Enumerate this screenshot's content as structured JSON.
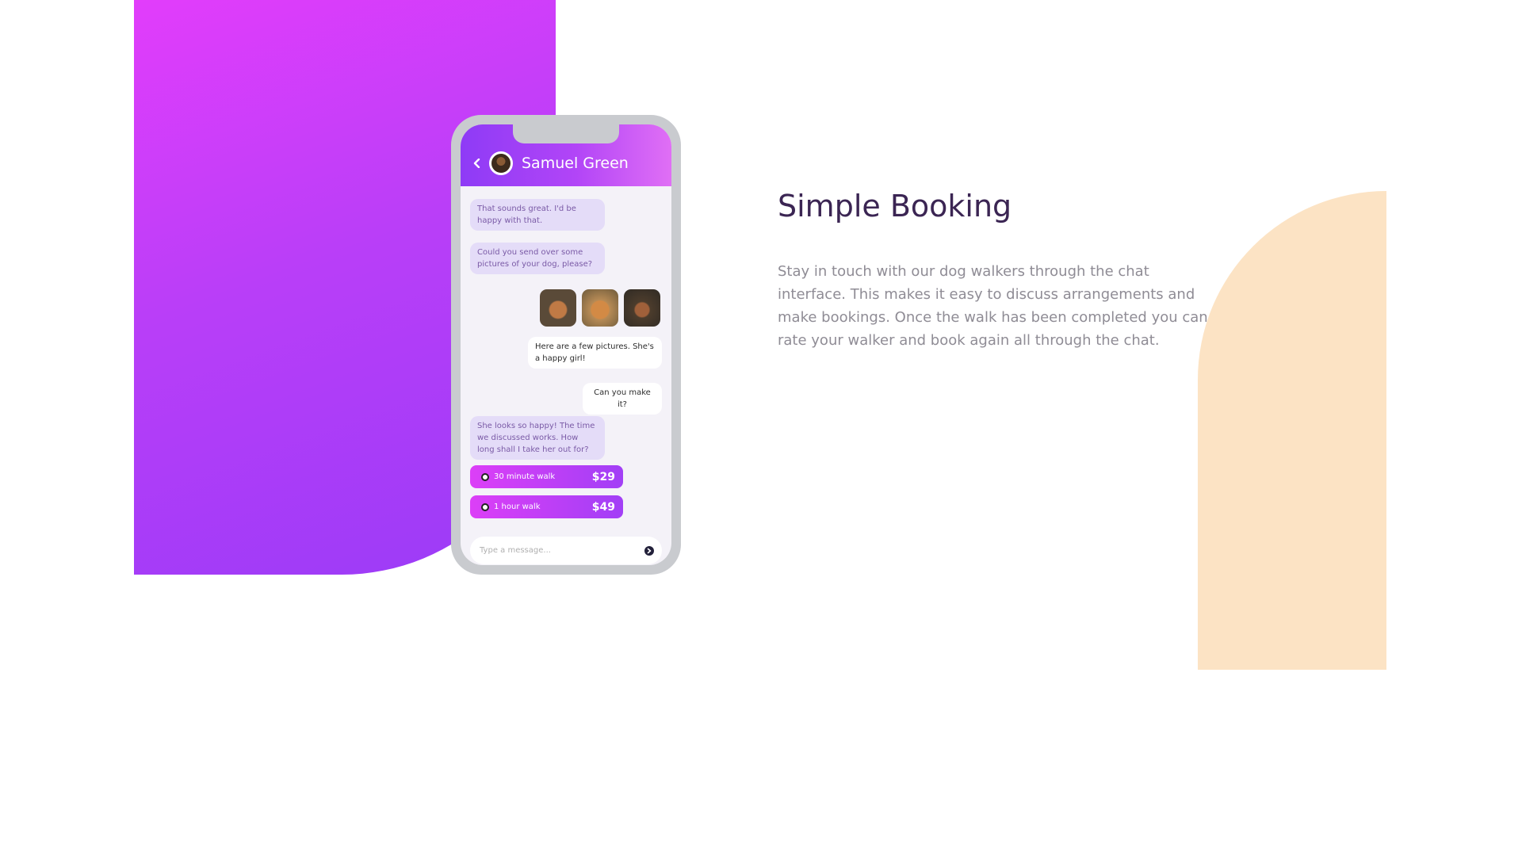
{
  "chat": {
    "contact_name": "Samuel Green",
    "messages": [
      {
        "side": "in",
        "text": "That sounds great. I'd be happy with that."
      },
      {
        "side": "in",
        "text": "Could you send over some pictures of your dog, please?"
      },
      {
        "side": "out",
        "text": "Here are a few pictures. She's a happy girl!"
      },
      {
        "side": "out",
        "text": "Can you make it?"
      },
      {
        "side": "in",
        "text": "She looks so happy! The time we discussed works. How long shall I take her out for?"
      }
    ],
    "photos": [
      "dog-photo",
      "dog-photo",
      "dog-photo"
    ],
    "options": [
      {
        "label": "30 minute walk",
        "price": "$29"
      },
      {
        "label": "1 hour walk",
        "price": "$49"
      }
    ],
    "composer_placeholder": "Type a message..."
  },
  "section": {
    "title": "Simple Booking",
    "description": "Stay in touch with our dog walkers through the chat interface. This makes it easy to discuss arrangements and make bookings. Once the walk has been completed you can rate your walker and book again all through the chat."
  },
  "colors": {
    "accent_purple": "#9a3bf7",
    "accent_magenta": "#e23dfb",
    "peach": "#fce3c4",
    "heading": "#3b2553",
    "body_text": "#8f8c95"
  },
  "icons": {
    "back": "chevron-left-icon",
    "send": "send-arrow-icon",
    "radio": "radio-button-icon"
  }
}
